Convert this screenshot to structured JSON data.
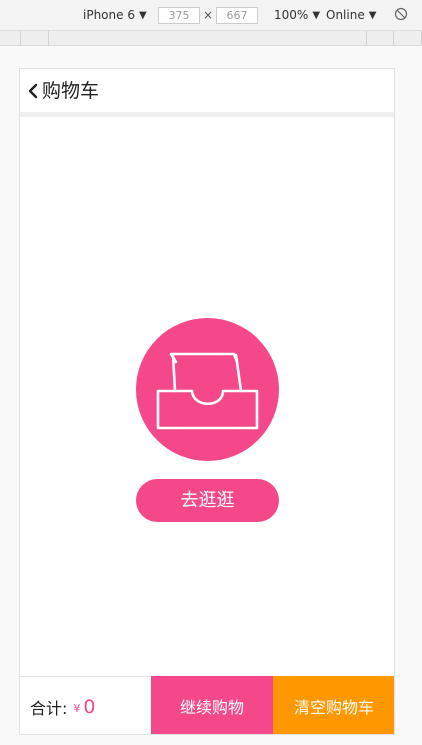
{
  "devtools": {
    "device": "iPhone 6",
    "width": "375",
    "height": "667",
    "times_sign": "×",
    "zoom": "100%",
    "network": "Online",
    "caret": "▼"
  },
  "header": {
    "title": "购物车"
  },
  "empty": {
    "go_shopping_label": "去逛逛"
  },
  "footer": {
    "total_label": "合计:",
    "currency_symbol": "¥",
    "total_amount": "0",
    "continue_label": "继续购物",
    "clear_label": "清空购物车"
  },
  "colors": {
    "accent_pink": "#f4488b",
    "accent_orange": "#fe9700"
  },
  "icons": {
    "back": "chevron-left-icon",
    "empty_cart": "empty-tray-icon",
    "rotate": "rotate-icon"
  }
}
